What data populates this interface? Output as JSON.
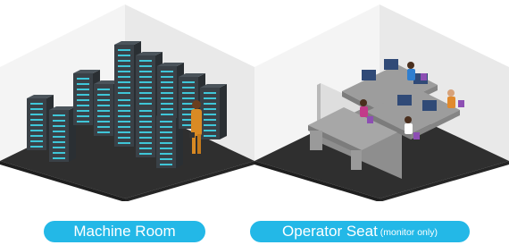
{
  "labels": {
    "machine_room": "Machine Room",
    "operator_seat": "Operator Seat",
    "operator_note": "(monitor only)"
  },
  "colors": {
    "accent": "#23b8e7",
    "floor": "#2f2f2f",
    "wall": "#f2f2f2",
    "rack": "#3a4147",
    "rack_light": "#3fc6d8",
    "desk": "#8f8f8f",
    "chair": "#8d4fb3"
  },
  "icons": {
    "machine_room": "server-room-illustration",
    "operator_seat": "operator-office-illustration"
  }
}
